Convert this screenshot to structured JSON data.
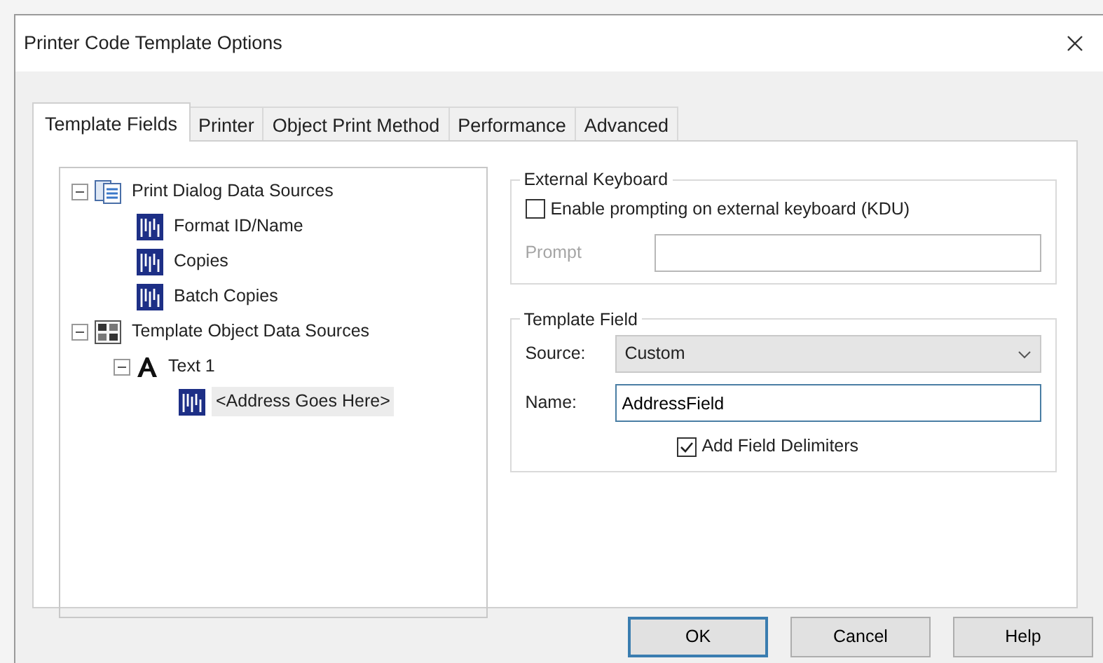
{
  "window": {
    "title": "Printer Code Template Options"
  },
  "tabs": [
    {
      "label": "Template Fields",
      "selected": true
    },
    {
      "label": "Printer",
      "selected": false
    },
    {
      "label": "Object Print Method",
      "selected": false
    },
    {
      "label": "Performance",
      "selected": false
    },
    {
      "label": "Advanced",
      "selected": false
    }
  ],
  "tree": [
    {
      "kind": "group",
      "label": "Print Dialog Data Sources",
      "expanded": true,
      "selected": false,
      "children": [
        {
          "kind": "field",
          "label": "Format ID/Name",
          "selected": false
        },
        {
          "kind": "field",
          "label": "Copies",
          "selected": false
        },
        {
          "kind": "field",
          "label": "Batch Copies",
          "selected": false
        }
      ]
    },
    {
      "kind": "objects",
      "label": "Template Object Data Sources",
      "expanded": true,
      "selected": false,
      "children": [
        {
          "kind": "text",
          "label": "Text 1",
          "expanded": true,
          "selected": false,
          "children": [
            {
              "kind": "field",
              "label": "<Address Goes Here>",
              "selected": true
            }
          ]
        }
      ]
    }
  ],
  "external_keyboard": {
    "title": "External Keyboard",
    "enable_prompting": {
      "label": "Enable prompting on external keyboard (KDU)",
      "checked": false
    },
    "prompt": {
      "label": "Prompt",
      "disabled": true
    }
  },
  "template_field": {
    "title": "Template Field",
    "source": {
      "label": "Source:",
      "value": "Custom"
    },
    "name": {
      "label": "Name:",
      "value": "AddressField"
    },
    "add_delimiters": {
      "label": "Add Field Delimiters",
      "checked": true
    }
  },
  "buttons": [
    {
      "label": "OK",
      "default": true
    },
    {
      "label": "Cancel",
      "default": false
    },
    {
      "label": "Help",
      "default": false
    }
  ]
}
